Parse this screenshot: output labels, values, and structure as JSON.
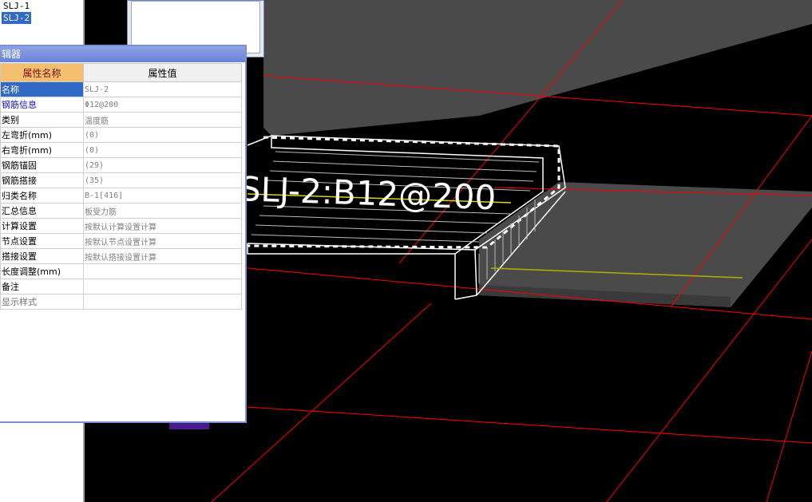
{
  "tree": {
    "items": [
      {
        "label": "SLJ-1",
        "selected": false
      },
      {
        "label": "SLJ-2",
        "selected": true
      }
    ]
  },
  "property_editor": {
    "title": "辑器",
    "header_name": "属性名称",
    "header_value": "属性值",
    "rows": [
      {
        "name": "名称",
        "value": "SLJ-2",
        "selected": true,
        "style": "normal"
      },
      {
        "name": "钢筋信息",
        "value": "Φ12@200",
        "selected": false,
        "style": "blue"
      },
      {
        "name": "类别",
        "value": "温度筋",
        "selected": false,
        "style": "normal"
      },
      {
        "name": "左弯折(mm)",
        "value": "(0)",
        "selected": false,
        "style": "normal"
      },
      {
        "name": "右弯折(mm)",
        "value": "(0)",
        "selected": false,
        "style": "normal"
      },
      {
        "name": "钢筋锚固",
        "value": "(29)",
        "selected": false,
        "style": "normal"
      },
      {
        "name": "钢筋搭接",
        "value": "(35)",
        "selected": false,
        "style": "normal"
      },
      {
        "name": "归类名称",
        "value": "B-1[416]",
        "selected": false,
        "style": "normal"
      },
      {
        "name": "汇总信息",
        "value": "板受力筋",
        "selected": false,
        "style": "normal"
      },
      {
        "name": "计算设置",
        "value": "按默认计算设置计算",
        "selected": false,
        "style": "normal"
      },
      {
        "name": "节点设置",
        "value": "按默认节点设置计算",
        "selected": false,
        "style": "normal"
      },
      {
        "name": "搭接设置",
        "value": "按默认搭接设置计算",
        "selected": false,
        "style": "normal"
      },
      {
        "name": "长度调整(mm)",
        "value": "",
        "selected": false,
        "style": "normal"
      },
      {
        "name": "备注",
        "value": "",
        "selected": false,
        "style": "normal"
      },
      {
        "name": "显示样式",
        "value": "",
        "selected": false,
        "style": "gray"
      }
    ]
  },
  "viewport": {
    "rebar_label": "SLJ-2:B12@200",
    "colors": {
      "background": "#000000",
      "slab": "#4a4a4a",
      "grid_line": "#ff0000",
      "outline": "#ffffff",
      "rebar": "#d8d800"
    }
  }
}
